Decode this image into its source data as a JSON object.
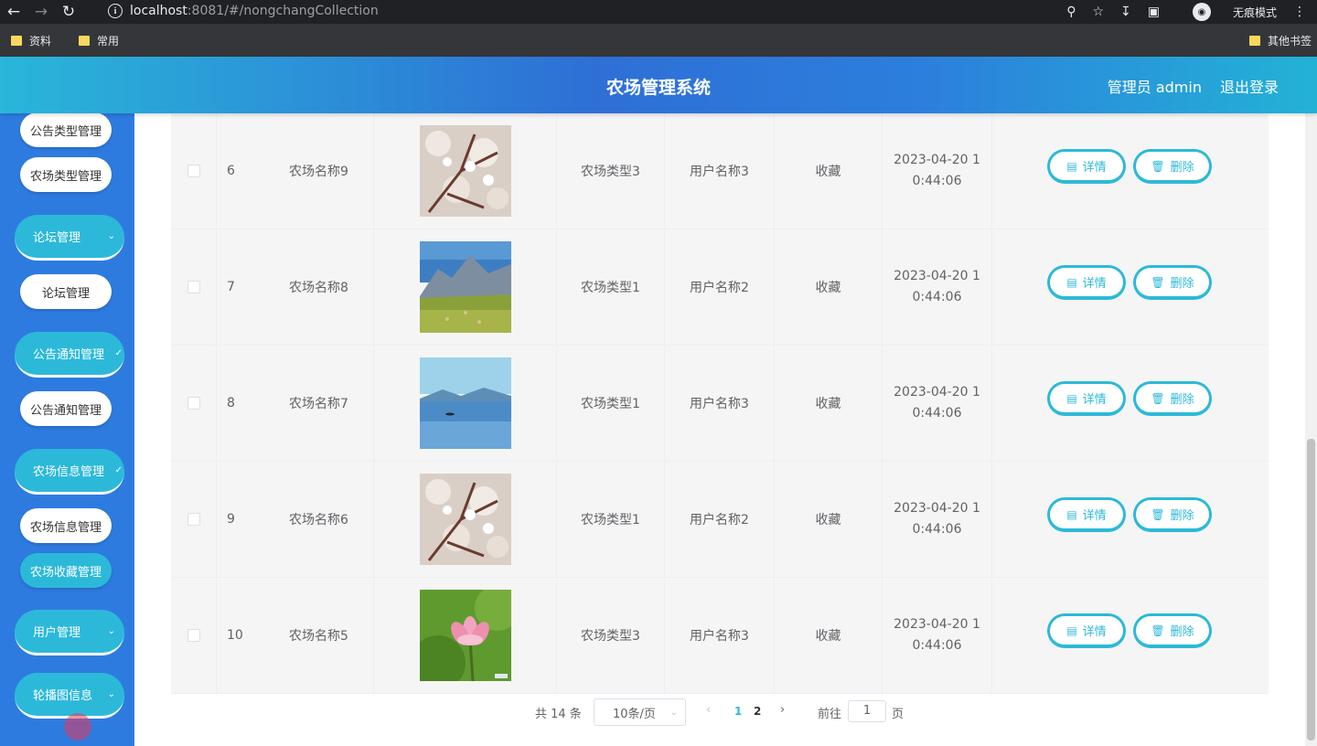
{
  "browser": {
    "url_host": "localhost",
    "url_rest": ":8081/#/nongchangCollection",
    "incognito_label": "无痕模式",
    "bookmarks": [
      "资料",
      "常用"
    ],
    "bookmarks_right": "其他书签"
  },
  "header": {
    "title": "农场管理系统",
    "user": "管理员 admin",
    "logout": "退出登录"
  },
  "sidebar": {
    "items": [
      {
        "label": "公告类型管理"
      },
      {
        "label": "农场类型管理"
      },
      {
        "label": "论坛管理",
        "group": true
      },
      {
        "label": "论坛管理"
      },
      {
        "label": "公告通知管理",
        "group": true
      },
      {
        "label": "公告通知管理"
      },
      {
        "label": "农场信息管理",
        "group": true
      },
      {
        "label": "农场信息管理"
      },
      {
        "label": "农场收藏管理",
        "active": true
      },
      {
        "label": "用户管理",
        "group": true
      },
      {
        "label": "轮播图信息",
        "group": true
      }
    ]
  },
  "table": {
    "rows": [
      {
        "index": "6",
        "name": "农场名称9",
        "image": "blossom",
        "type": "农场类型3",
        "user": "用户名称3",
        "action_type": "收藏",
        "time_line1": "2023-04-20 1",
        "time_line2": "0:44:06"
      },
      {
        "index": "7",
        "name": "农场名称8",
        "image": "mountain",
        "type": "农场类型1",
        "user": "用户名称2",
        "action_type": "收藏",
        "time_line1": "2023-04-20 1",
        "time_line2": "0:44:06"
      },
      {
        "index": "8",
        "name": "农场名称7",
        "image": "lake",
        "type": "农场类型1",
        "user": "用户名称3",
        "action_type": "收藏",
        "time_line1": "2023-04-20 1",
        "time_line2": "0:44:06"
      },
      {
        "index": "9",
        "name": "农场名称6",
        "image": "blossom",
        "type": "农场类型1",
        "user": "用户名称2",
        "action_type": "收藏",
        "time_line1": "2023-04-20 1",
        "time_line2": "0:44:06"
      },
      {
        "index": "10",
        "name": "农场名称5",
        "image": "lotus",
        "type": "农场类型3",
        "user": "用户名称3",
        "action_type": "收藏",
        "time_line1": "2023-04-20 1",
        "time_line2": "0:44:06"
      }
    ],
    "detail_label": "详情",
    "delete_label": "删除"
  },
  "pagination": {
    "total": "共 14 条",
    "page_size": "10条/页",
    "pages": [
      "1",
      "2"
    ],
    "current_page": "1",
    "goto_label": "前往",
    "goto_value": "1",
    "page_unit": "页"
  },
  "colors": {
    "accent": "#2cb9d9",
    "sidebar": "#2e7be0"
  }
}
